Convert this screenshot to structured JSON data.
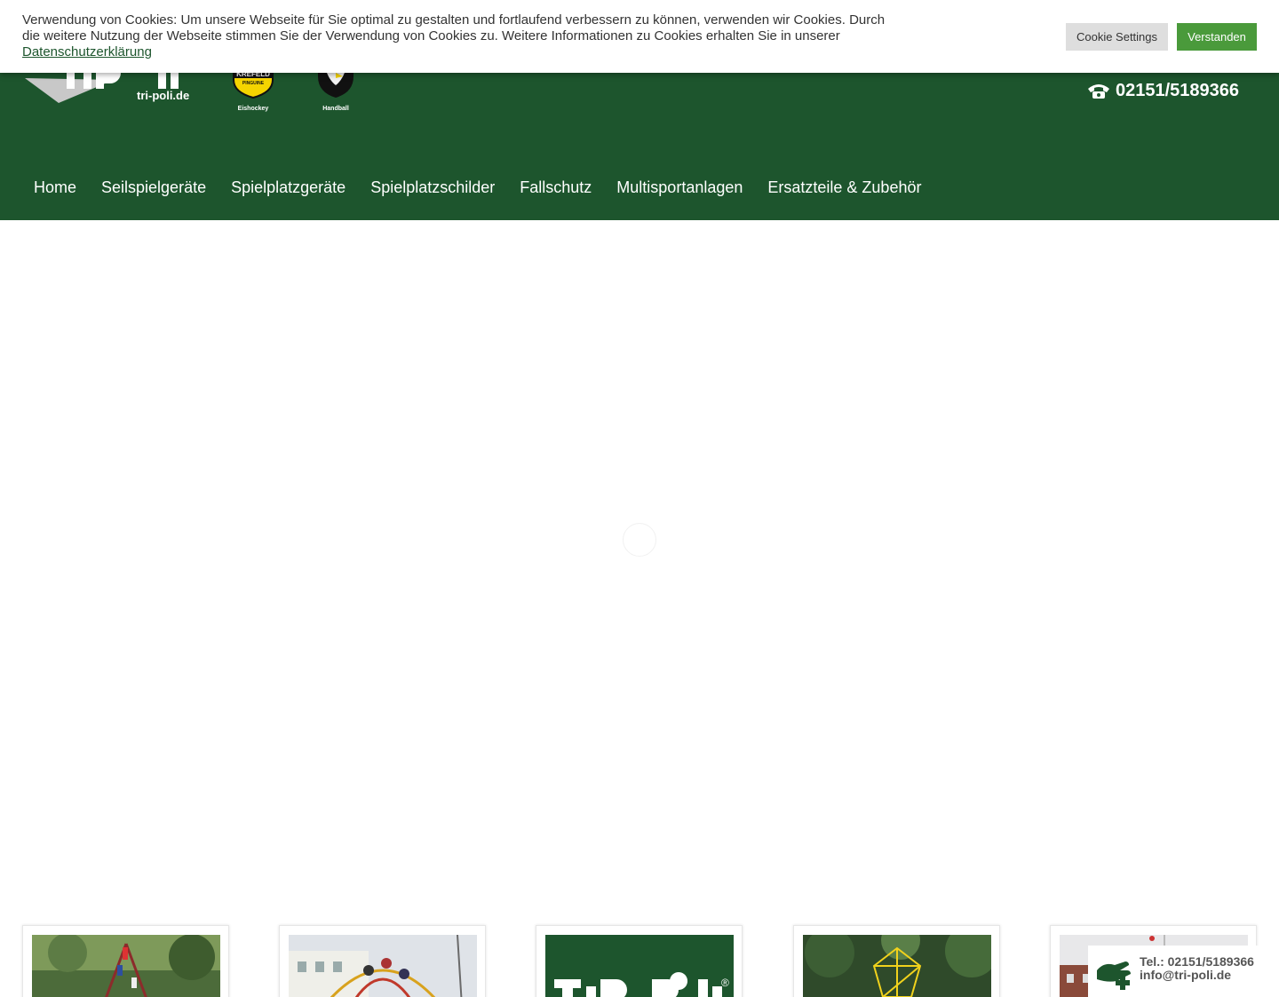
{
  "cookie": {
    "text": "Verwendung von Cookies: Um unsere Webseite für Sie optimal zu gestalten und fortlaufend verbessern zu können, verwenden wir Cookies. Durch die weitere Nutzung der Webseite stimmen Sie der Verwendung von Cookies zu. Weitere Informationen zu Cookies erhalten Sie in unserer",
    "privacy_link": "Datenschutzerklärung",
    "settings_button": "Cookie Settings",
    "accept_button": "Verstanden"
  },
  "header": {
    "logo_domain": "tri-poli.de",
    "partners": [
      {
        "label": "Eishockey",
        "badge_text": "KREFELD",
        "sub": "PINGUINE",
        "icon": "penguin-shield-icon"
      },
      {
        "label": "Handball",
        "icon": "eagle-icon"
      }
    ],
    "phone": "02151/5189366",
    "phone_icon": "telephone-icon"
  },
  "nav": {
    "items": [
      {
        "label": "Home"
      },
      {
        "label": "Seilspielgeräte"
      },
      {
        "label": "Spielplatzgeräte"
      },
      {
        "label": "Spielplatzschilder"
      },
      {
        "label": "Fallschutz"
      },
      {
        "label": "Multisportanlagen"
      },
      {
        "label": "Ersatzteile & Zubehör"
      }
    ]
  },
  "cards": [
    {
      "name": "playground-climbing-photo"
    },
    {
      "name": "climbing-dome-photo"
    },
    {
      "name": "tripoli-logo-card"
    },
    {
      "name": "yellow-climbing-frame-photo"
    },
    {
      "name": "building-photo"
    }
  ],
  "contact": {
    "tel": "Tel.: 02151/5189366",
    "mail": "info@tri-poli.de",
    "icon": "contact-hand-plus-icon"
  },
  "colors": {
    "brand_green": "#1d552d",
    "accept_green": "#4a9a3b"
  }
}
